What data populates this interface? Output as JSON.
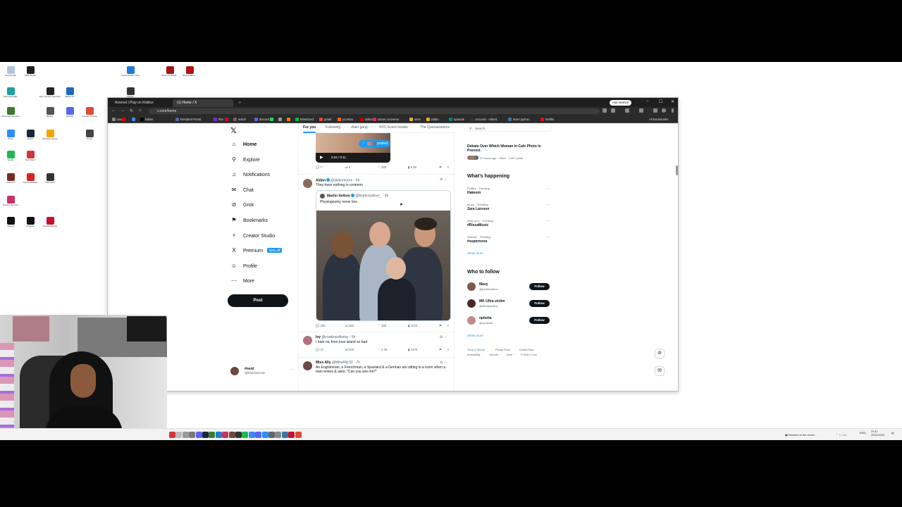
{
  "desktop": {
    "icons": [
      {
        "label": "Recycle Bin",
        "color": "#b0c4de"
      },
      {
        "label": "OBS Studio",
        "color": "#202020"
      },
      {
        "label": "Visual Studio Code",
        "color": "#1e7bd6"
      },
      {
        "label": "SGW 10 NIGHT...",
        "color": "#a01616"
      },
      {
        "label": "Dark & Moon...",
        "color": "#b31313"
      },
      {
        "label": "Microsoft Edge",
        "color": "#1aa3a0"
      },
      {
        "label": "Epic Games Launcher",
        "color": "#222222"
      },
      {
        "label": "Battle.net",
        "color": "#1d69c4"
      },
      {
        "label": "Roblox",
        "color": "#333333"
      },
      {
        "label": "Minecraft Launcher",
        "color": "#3c7a2c"
      },
      {
        "label": "Blobby",
        "color": "#555555"
      },
      {
        "label": "Discord",
        "color": "#5865f2"
      },
      {
        "label": "Google Chrome",
        "color": "#dd4b39"
      },
      {
        "label": "Zoom",
        "color": "#2d8cff"
      },
      {
        "label": "Steam",
        "color": "#1b2838"
      },
      {
        "label": "Rockstar Games",
        "color": "#f4a300"
      },
      {
        "label": "Cemu",
        "color": "#444444"
      },
      {
        "label": "Spotify",
        "color": "#1db954"
      },
      {
        "label": "Riot Client",
        "color": "#d13639"
      },
      {
        "label": "CasterTv",
        "color": "#7a2929"
      },
      {
        "label": "Adobe Creative",
        "color": "#da1f26"
      },
      {
        "label": "SSD HDD",
        "color": "#333333"
      },
      {
        "label": "DaVinci Resolve",
        "color": "#c93063"
      },
      {
        "label": "Capcut",
        "color": "#111111"
      },
      {
        "label": "Audacity",
        "color": "#111111"
      },
      {
        "label": "Acrobat Reader",
        "color": "#c8102e"
      }
    ]
  },
  "browser": {
    "tabs": [
      {
        "label": "Arsenal | Play on Roblox",
        "active": false
      },
      {
        "label": "(1) Home / X",
        "active": true
      }
    ],
    "new_tab": "+",
    "ask_gemini": "Ask Gemini",
    "window_controls": {
      "minimize": "–",
      "maximize": "☐",
      "close": "✕"
    },
    "url": "x.com/home",
    "bookmarks": [
      {
        "label": "ueu",
        "color": "#888888"
      },
      {
        "label": "",
        "color": "#cc0000"
      },
      {
        "label": "",
        "color": "#4285f4"
      },
      {
        "label": "twitter",
        "color": "#000000"
      },
      {
        "label": "Resident Portal",
        "color": "#4a6fa5"
      },
      {
        "label": "hbo",
        "color": "#7b2cbf"
      },
      {
        "label": "",
        "color": "#e50914"
      },
      {
        "label": "watch",
        "color": "#666666"
      },
      {
        "label": "discord",
        "color": "#5865f2"
      },
      {
        "label": "",
        "color": "#25d366"
      },
      {
        "label": "",
        "color": "#999999"
      },
      {
        "label": "",
        "color": "#ff7a00"
      },
      {
        "label": "letterboxd",
        "color": "#00c030"
      },
      {
        "label": "gmail",
        "color": "#ea4335"
      },
      {
        "label": "ycombe",
        "color": "#ff6600"
      },
      {
        "label": "dafont",
        "color": "#c00000"
      },
      {
        "label": "steven universe",
        "color": "#e91e63"
      },
      {
        "label": "sims",
        "color": "#e2b33a"
      },
      {
        "label": "tabbo",
        "color": "#f9a825"
      },
      {
        "label": "episode",
        "color": "#00897b"
      },
      {
        "label": "Account - edited",
        "color": "#333333"
      },
      {
        "label": "learn python",
        "color": "#3776ab"
      },
      {
        "label": "Netflix",
        "color": "#e50914"
      }
    ],
    "all_bookmarks": "All Bookmarks"
  },
  "x": {
    "nav": [
      {
        "label": "Home",
        "icon": "⌂",
        "icon_name": "home-icon",
        "active": true
      },
      {
        "label": "Explore",
        "icon": "⚲",
        "icon_name": "search-icon",
        "active": false
      },
      {
        "label": "Notifications",
        "icon": "♫",
        "icon_name": "bell-icon",
        "active": false
      },
      {
        "label": "Chat",
        "icon": "✉",
        "icon_name": "chat-icon",
        "active": false
      },
      {
        "label": "Grok",
        "icon": "⊘",
        "icon_name": "grok-icon",
        "active": false
      },
      {
        "label": "Bookmarks",
        "icon": "⚑",
        "icon_name": "bookmark-icon",
        "active": false
      },
      {
        "label": "Creator Studio",
        "icon": "⚡",
        "icon_name": "creator-studio-icon",
        "active": false
      },
      {
        "label": "Premium",
        "icon": "X",
        "icon_name": "premium-icon",
        "active": false,
        "badge": "50% off"
      },
      {
        "label": "Profile",
        "icon": "☺",
        "icon_name": "profile-icon",
        "active": false
      },
      {
        "label": "More",
        "icon": "⋯",
        "icon_name": "more-icon",
        "active": false
      }
    ],
    "post_button": "Post",
    "account": {
      "name": "#nerd",
      "handle": "@Rhack81cam"
    },
    "feed_tabs": [
      "For you",
      "Following",
      "drain gang",
      "NYC Event Insider",
      "The Quenaissance"
    ],
    "video_tweet": {
      "time": "0:04 / 0:11",
      "posted_label": "posted",
      "stats": {
        "replies": "7",
        "reposts": "9",
        "likes": "290",
        "views": "5.3K"
      }
    },
    "tweet1": {
      "name": "Aidan",
      "handle": "@aidanmoore · 6h",
      "text": "They have nothing in common",
      "quote": {
        "name": "Martin Sellner",
        "handle": "@MartinSellner_ · 8h",
        "text": "Physiognomy never lies."
      },
      "stats": {
        "replies": "200",
        "reposts": "255",
        "likes": "496",
        "views": "207K"
      }
    },
    "tweet2": {
      "name": "Ivy",
      "handle": "@cowboyslikeivy · 6h",
      "text": "I hate nic from love island so bad",
      "stats": {
        "replies": "37",
        "reposts": "208",
        "likes": "2.4K",
        "views": "127K"
      }
    },
    "tweet3": {
      "name": "Miss Ally",
      "handle": "@MissAlly.91 · 7h",
      "text": "An Englishman, a Frenchman, a Spaniard & a German are sitting in a room when a man enters & asks, \"Can you see me?\""
    },
    "right": {
      "search_placeholder": "Search",
      "top_story": {
        "title": "Debate Over Which Woman in Cafe Photo Is Poorest",
        "meta": "22 hours ago · Other · 2,491 posts"
      },
      "happening_title": "What’s happening",
      "trends": [
        {
          "context": "Politics · Trending",
          "name": "Hakeem"
        },
        {
          "context": "Music · Trending",
          "name": "Zara Larsson"
        },
        {
          "context": "Only on X · Trending",
          "name": "#RissaMusic"
        },
        {
          "context": "Science · Trending",
          "name": "#supernova"
        }
      ],
      "show_more": "Show more",
      "who_title": "Who to follow",
      "follows": [
        {
          "name": "Mavy",
          "handle": "@partnerdemo",
          "color": "#7a5a4a"
        },
        {
          "name": "MK Ultra victim",
          "handle": "@MKsaysultra",
          "color": "#4a2a2a"
        },
        {
          "name": "ophelia",
          "handle": "@opheelia",
          "color": "#c08a8a"
        }
      ],
      "follow_label": "Follow",
      "footer": [
        "Terms of Service",
        "Privacy Policy",
        "Cookie Policy",
        "Accessibility",
        "Ads info",
        "More ···",
        "© 2026 X Corp."
      ]
    }
  },
  "taskbar": {
    "tray_text": "Masters of the Unive...",
    "lang": "ENG",
    "time": "23:42",
    "date": "20/04/2026"
  }
}
